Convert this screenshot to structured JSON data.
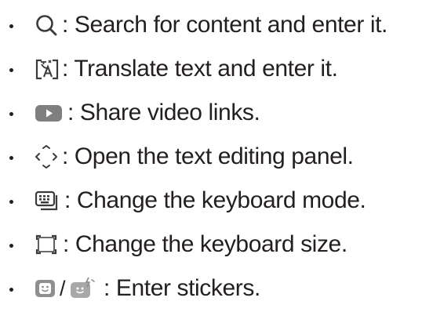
{
  "items": [
    {
      "icon": "search-icon",
      "text": ": Search for content and enter it."
    },
    {
      "icon": "translate-icon",
      "text": ": Translate text and enter it."
    },
    {
      "icon": "video-share-icon",
      "text": ": Share video links."
    },
    {
      "icon": "text-editing-panel-icon",
      "text": ": Open the text editing panel."
    },
    {
      "icon": "keyboard-mode-icon",
      "text": ": Change the keyboard mode."
    },
    {
      "icon": "keyboard-size-icon",
      "text": ": Change the keyboard size."
    },
    {
      "icon": "sticker-icons",
      "separator": "/",
      "text": ": Enter stickers."
    }
  ],
  "colors": {
    "text": "#231f20",
    "icon_dark": "#3b3b3b",
    "icon_gray": "#8f8f8f",
    "icon_light": "#bdbdbd"
  }
}
